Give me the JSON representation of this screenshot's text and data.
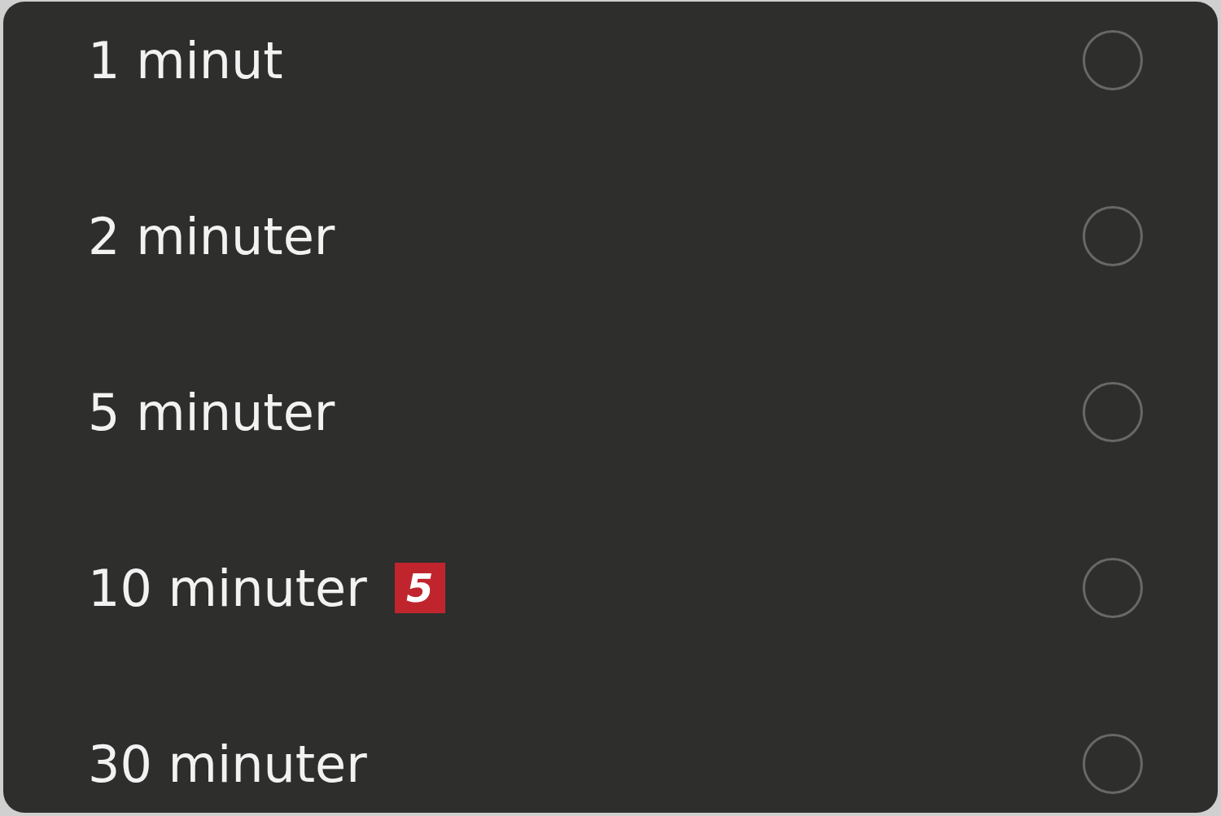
{
  "options": [
    {
      "label": "1 minut",
      "selected": false
    },
    {
      "label": "2 minuter",
      "selected": false
    },
    {
      "label": "5 minuter",
      "selected": false
    },
    {
      "label": "10 minuter",
      "badge": "5",
      "selected": false
    },
    {
      "label": "30 minuter",
      "selected": false
    }
  ]
}
